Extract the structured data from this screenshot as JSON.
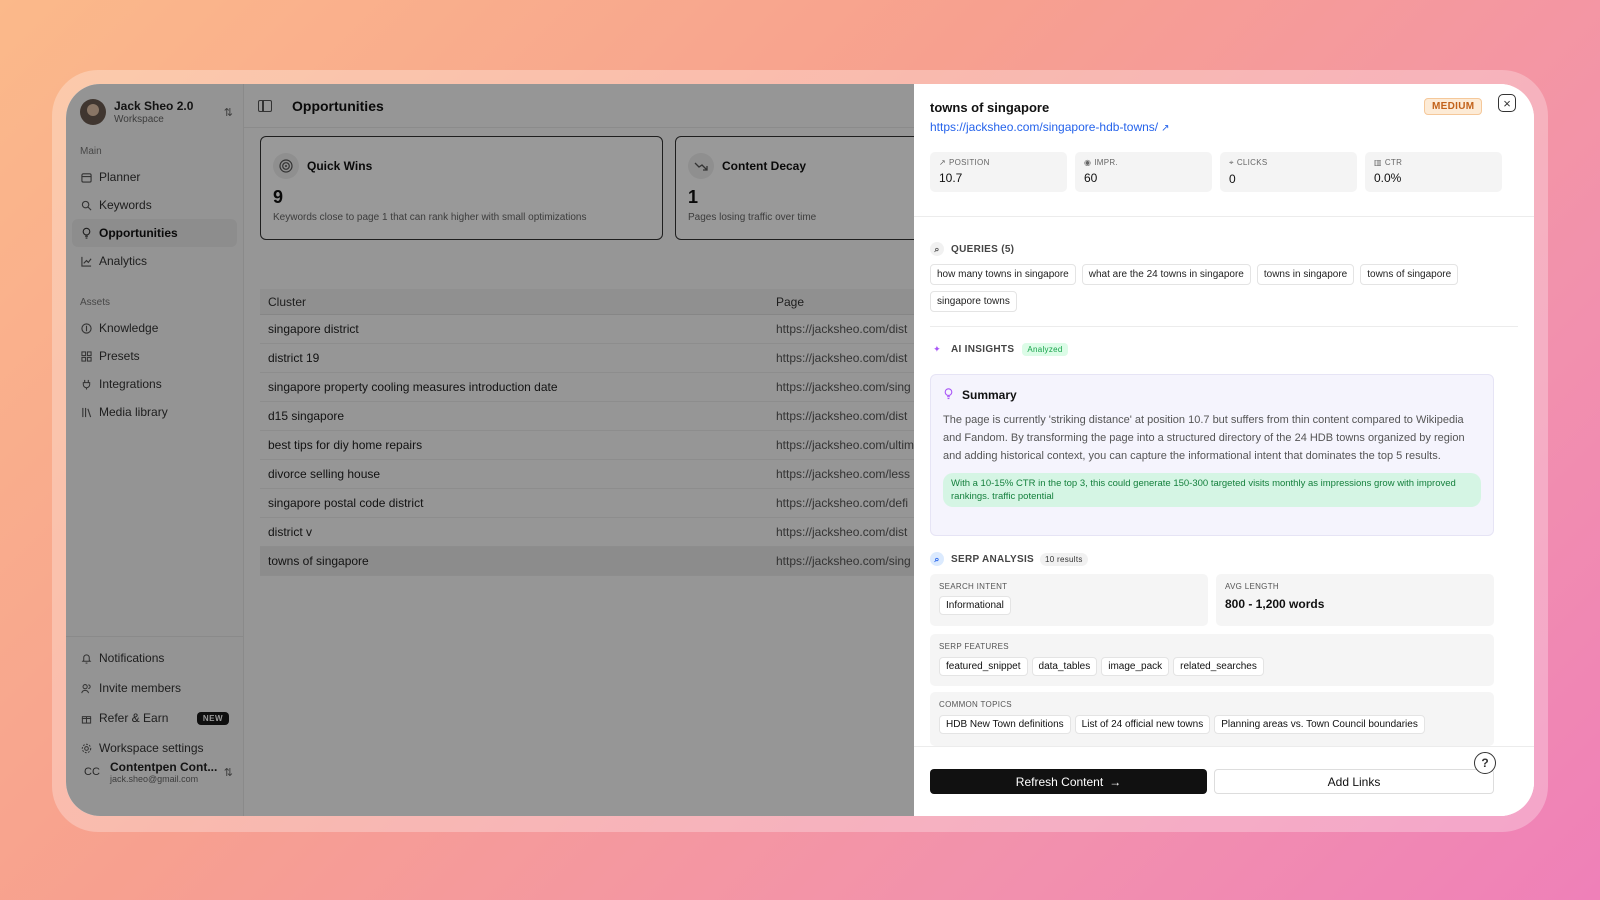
{
  "workspace": {
    "name": "Jack Sheo 2.0",
    "subtitle": "Workspace"
  },
  "sidebar": {
    "main_label": "Main",
    "main_items": [
      {
        "label": "Planner",
        "icon": "calendar-icon"
      },
      {
        "label": "Keywords",
        "icon": "search-icon"
      },
      {
        "label": "Opportunities",
        "icon": "lightbulb-icon"
      },
      {
        "label": "Analytics",
        "icon": "chart-icon"
      }
    ],
    "assets_label": "Assets",
    "asset_items": [
      {
        "label": "Knowledge",
        "icon": "book-icon"
      },
      {
        "label": "Presets",
        "icon": "grid-icon"
      },
      {
        "label": "Integrations",
        "icon": "plug-icon"
      },
      {
        "label": "Media library",
        "icon": "library-icon"
      }
    ],
    "bottom_items": [
      {
        "label": "Notifications",
        "icon": "bell-icon"
      },
      {
        "label": "Invite members",
        "icon": "users-icon"
      },
      {
        "label": "Refer & Earn",
        "icon": "gift-icon",
        "badge": "NEW"
      },
      {
        "label": "Workspace settings",
        "icon": "gear-icon"
      }
    ],
    "account": {
      "initials": "CC",
      "name": "Contentpen Cont...",
      "email": "jack.sheo@gmail.com"
    }
  },
  "main": {
    "title": "Opportunities",
    "cards": [
      {
        "title": "Quick Wins",
        "count": "9",
        "desc": "Keywords close to page 1 that can rank higher with small optimizations"
      },
      {
        "title": "Content Decay",
        "count": "1",
        "desc": "Pages losing traffic over time"
      }
    ],
    "table": {
      "headers": [
        "Cluster",
        "Page"
      ],
      "rows": [
        {
          "cluster": "singapore district",
          "page": "https://jacksheo.com/dist"
        },
        {
          "cluster": "district 19",
          "page": "https://jacksheo.com/dist"
        },
        {
          "cluster": "singapore property cooling measures introduction date",
          "page": "https://jacksheo.com/sing"
        },
        {
          "cluster": "d15 singapore",
          "page": "https://jacksheo.com/dist"
        },
        {
          "cluster": "best tips for diy home repairs",
          "page": "https://jacksheo.com/ultim"
        },
        {
          "cluster": "divorce selling house",
          "page": "https://jacksheo.com/less"
        },
        {
          "cluster": "singapore postal code district",
          "page": "https://jacksheo.com/defi"
        },
        {
          "cluster": "district v",
          "page": "https://jacksheo.com/dist"
        },
        {
          "cluster": "towns of singapore",
          "page": "https://jacksheo.com/sing"
        }
      ]
    }
  },
  "detail": {
    "title": "towns of singapore",
    "url": "https://jacksheo.com/singapore-hdb-towns/",
    "priority": "MEDIUM",
    "metrics": [
      {
        "label": "POSITION",
        "value": "10.7",
        "icon": "trend-up-icon"
      },
      {
        "label": "IMPR.",
        "value": "60",
        "icon": "eye-icon"
      },
      {
        "label": "CLICKS",
        "value": "0",
        "icon": "cursor-icon"
      },
      {
        "label": "CTR",
        "value": "0.0%",
        "icon": "bar-chart-icon"
      }
    ],
    "queries_label": "QUERIES (5)",
    "queries": [
      "how many towns in singapore",
      "what are the 24 towns in singapore",
      "towns in singapore",
      "towns of singapore",
      "singapore towns"
    ],
    "ai_label": "AI INSIGHTS",
    "ai_badge": "Analyzed",
    "summary_title": "Summary",
    "summary_text": "The page is currently 'striking distance' at position 10.7 but suffers from thin content compared to Wikipedia and Fandom. By transforming the page into a structured directory of the 24 HDB towns organized by region and adding historical context, you can capture the informational intent that dominates the top 5 results.",
    "summary_note": "With a 10-15% CTR in the top 3, this could generate 150-300 targeted visits monthly as impressions grow with improved rankings. traffic potential",
    "serp_label": "SERP ANALYSIS",
    "serp_badge": "10 results",
    "search_intent_label": "SEARCH INTENT",
    "search_intent": "Informational",
    "avg_length_label": "AVG LENGTH",
    "avg_length": "800 - 1,200 words",
    "serp_features_label": "SERP FEATURES",
    "serp_features": [
      "featured_snippet",
      "data_tables",
      "image_pack",
      "related_searches"
    ],
    "common_topics_label": "COMMON TOPICS",
    "common_topics": [
      "HDB New Town definitions",
      "List of 24 official new towns",
      "Planning areas vs. Town Council boundaries"
    ],
    "refresh_label": "Refresh Content",
    "add_links_label": "Add Links"
  },
  "colors": {
    "accent_link": "#2563eb",
    "priority_bg": "#fdebd6",
    "priority_text": "#c2621a",
    "analyzed_text": "#16a34a"
  }
}
